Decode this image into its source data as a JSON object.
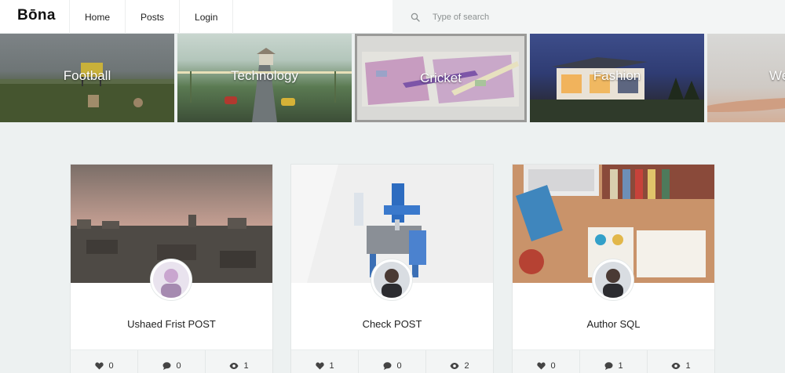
{
  "header": {
    "logo": "Bōna",
    "nav": [
      "Home",
      "Posts",
      "Login"
    ],
    "search": {
      "placeholder": "Type of search",
      "value": "",
      "icon": "search-icon"
    }
  },
  "categories": [
    {
      "label": "Football"
    },
    {
      "label": "Technology"
    },
    {
      "label": "Cricket"
    },
    {
      "label": "Fashion"
    },
    {
      "label": "We"
    }
  ],
  "posts": [
    {
      "title": "Ushaed Frist POST",
      "likes": "0",
      "comments": "0",
      "views": "1"
    },
    {
      "title": "Check POST",
      "likes": "1",
      "comments": "0",
      "views": "2"
    },
    {
      "title": "Author SQL",
      "likes": "0",
      "comments": "1",
      "views": "1"
    }
  ],
  "icons": {
    "like": "heart-icon",
    "comment": "comment-icon",
    "views": "eye-icon"
  },
  "colors": {
    "page_background": "#edf1f1",
    "header_background": "#ffffff",
    "search_background": "#f3f5f5",
    "stats_background": "#f3f5f5",
    "category_text": "#ffffff"
  }
}
